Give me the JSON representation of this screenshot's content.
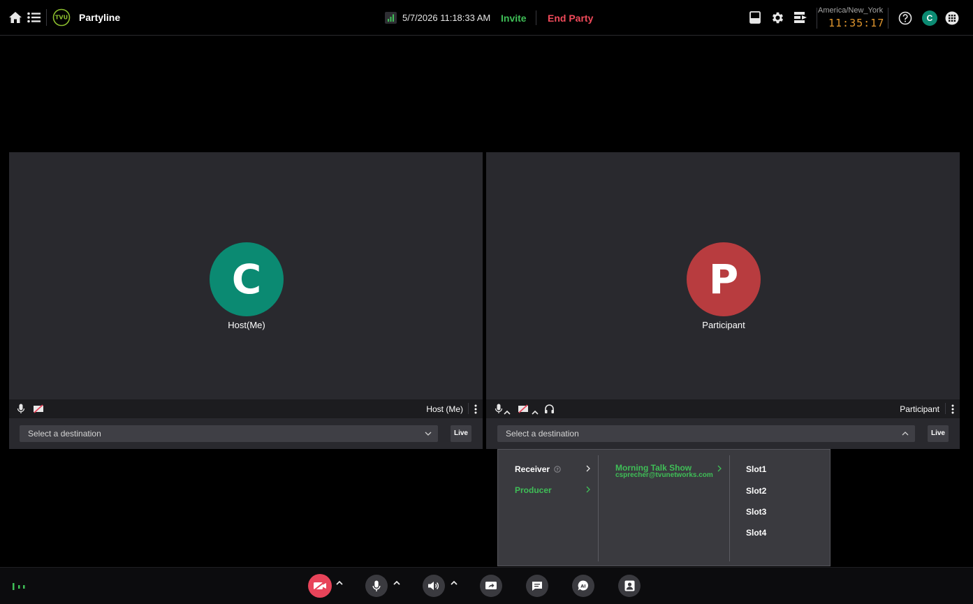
{
  "app": {
    "title": "Partyline",
    "logo_text": "TVU"
  },
  "header": {
    "datetime": "5/7/2026 11:18:33 AM",
    "invite_label": "Invite",
    "end_party_label": "End Party",
    "timezone": "America/New_York",
    "clock": "11:35:17",
    "user_initial": "C"
  },
  "tiles": [
    {
      "initial": "C",
      "avatar_color": "#0b8a72",
      "name": "Host(Me)",
      "footer_label": "Host (Me)",
      "destination_placeholder": "Select a destination",
      "live_label": "Live"
    },
    {
      "initial": "P",
      "avatar_color": "#b83c3f",
      "name": "Participant",
      "footer_label": "Participant",
      "destination_placeholder": "Select a destination",
      "live_label": "Live"
    }
  ],
  "destination_menu": {
    "categories": [
      {
        "label": "Receiver",
        "active": false
      },
      {
        "label": "Producer",
        "active": true
      }
    ],
    "producer": {
      "name": "Morning Talk Show",
      "email": "csprecher@tvunetworks.com"
    },
    "slots": [
      "Slot1",
      "Slot2",
      "Slot3",
      "Slot4"
    ]
  },
  "colors": {
    "accent_green": "#3fbf57",
    "danger_red": "#f04a5a",
    "clock_orange": "#e0962e",
    "camera_off_red": "#e8445a"
  }
}
